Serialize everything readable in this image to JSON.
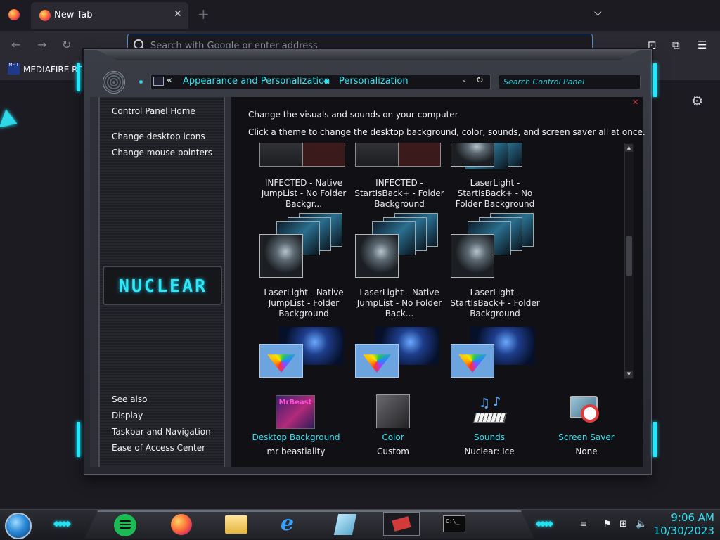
{
  "browser": {
    "tab": {
      "title": "New Tab",
      "close_glyph": "✕"
    },
    "new_tab_glyph": "+",
    "list_tabs_glyph": "⌵",
    "nav": {
      "back": "←",
      "forward": "→",
      "reload": "↻"
    },
    "urlbar": {
      "placeholder": "Search with Google or enter address",
      "value": ""
    },
    "toolbar_icons": {
      "pocket": "⊡",
      "extensions": "⧉",
      "menu": "☰"
    },
    "bookmarks": [
      {
        "label": "MEDIAFIRE RO",
        "favicon_text": "MF T"
      }
    ],
    "settings_glyph": "⚙"
  },
  "control_panel": {
    "breadcrumb": {
      "back_chevron": "«",
      "items": [
        "Appearance and Personalization",
        "Personalization"
      ],
      "dropdown_glyph": "⌄",
      "refresh_glyph": "↻"
    },
    "search": {
      "placeholder": "Search Control Panel"
    },
    "close_glyph": "✕",
    "left_nav": {
      "top_links": [
        "Control Panel Home",
        "Change desktop icons",
        "Change mouse pointers"
      ],
      "logo_text": "NUCLEAR",
      "see_also": "See also",
      "see_also_links": [
        "Display",
        "Taskbar and Navigation",
        "Ease of Access Center"
      ]
    },
    "heading": "Change the visuals and sounds on your computer",
    "subheading": "Click a theme to change the desktop background, color, sounds, and screen saver all at once.",
    "themes": [
      {
        "label": "INFECTED - Native JumpList - No Folder Backgr...",
        "thumb": "dark"
      },
      {
        "label": "INFECTED - StartIsBack+ - Folder Background",
        "thumb": "dark"
      },
      {
        "label": "LaserLight - StartIsBack+ - No Folder Background",
        "thumb": "laserlight"
      },
      {
        "label": "LaserLight - Native JumpList - Folder Background",
        "thumb": "laserlight"
      },
      {
        "label": "LaserLight - Native JumpList - No Folder Back...",
        "thumb": "laserlight"
      },
      {
        "label": "LaserLight - StartIsBack+ - Folder Background",
        "thumb": "laserlight"
      },
      {
        "label": "",
        "thumb": "galaxy-rainbow"
      },
      {
        "label": "",
        "thumb": "galaxy-rainbow"
      },
      {
        "label": "",
        "thumb": "galaxy-rainbow"
      }
    ],
    "scroll": {
      "up_glyph": "▲",
      "down_glyph": "▼"
    },
    "bottom": [
      {
        "label": "Desktop Background",
        "value": "mr beastiality",
        "icon_text": "MrBeast",
        "icon": "desktop-background-icon"
      },
      {
        "label": "Color",
        "value": "Custom",
        "icon": "color-swatch-icon"
      },
      {
        "label": "Sounds",
        "value": "Nuclear: Ice",
        "icon": "sounds-icon"
      },
      {
        "label": "Screen Saver",
        "value": "None",
        "icon": "screen-saver-icon"
      }
    ]
  },
  "taskbar": {
    "cmd_text": "C:\\_",
    "tray": {
      "flag": "⚑",
      "network": "⊞",
      "volume": "🔈"
    },
    "clock": {
      "time": "9:06 AM",
      "date": "10/30/2023"
    }
  },
  "colors": {
    "accent_cyan": "#2ee6f4",
    "window_bg": "#111115",
    "browser_bg": "#2b2a33"
  }
}
